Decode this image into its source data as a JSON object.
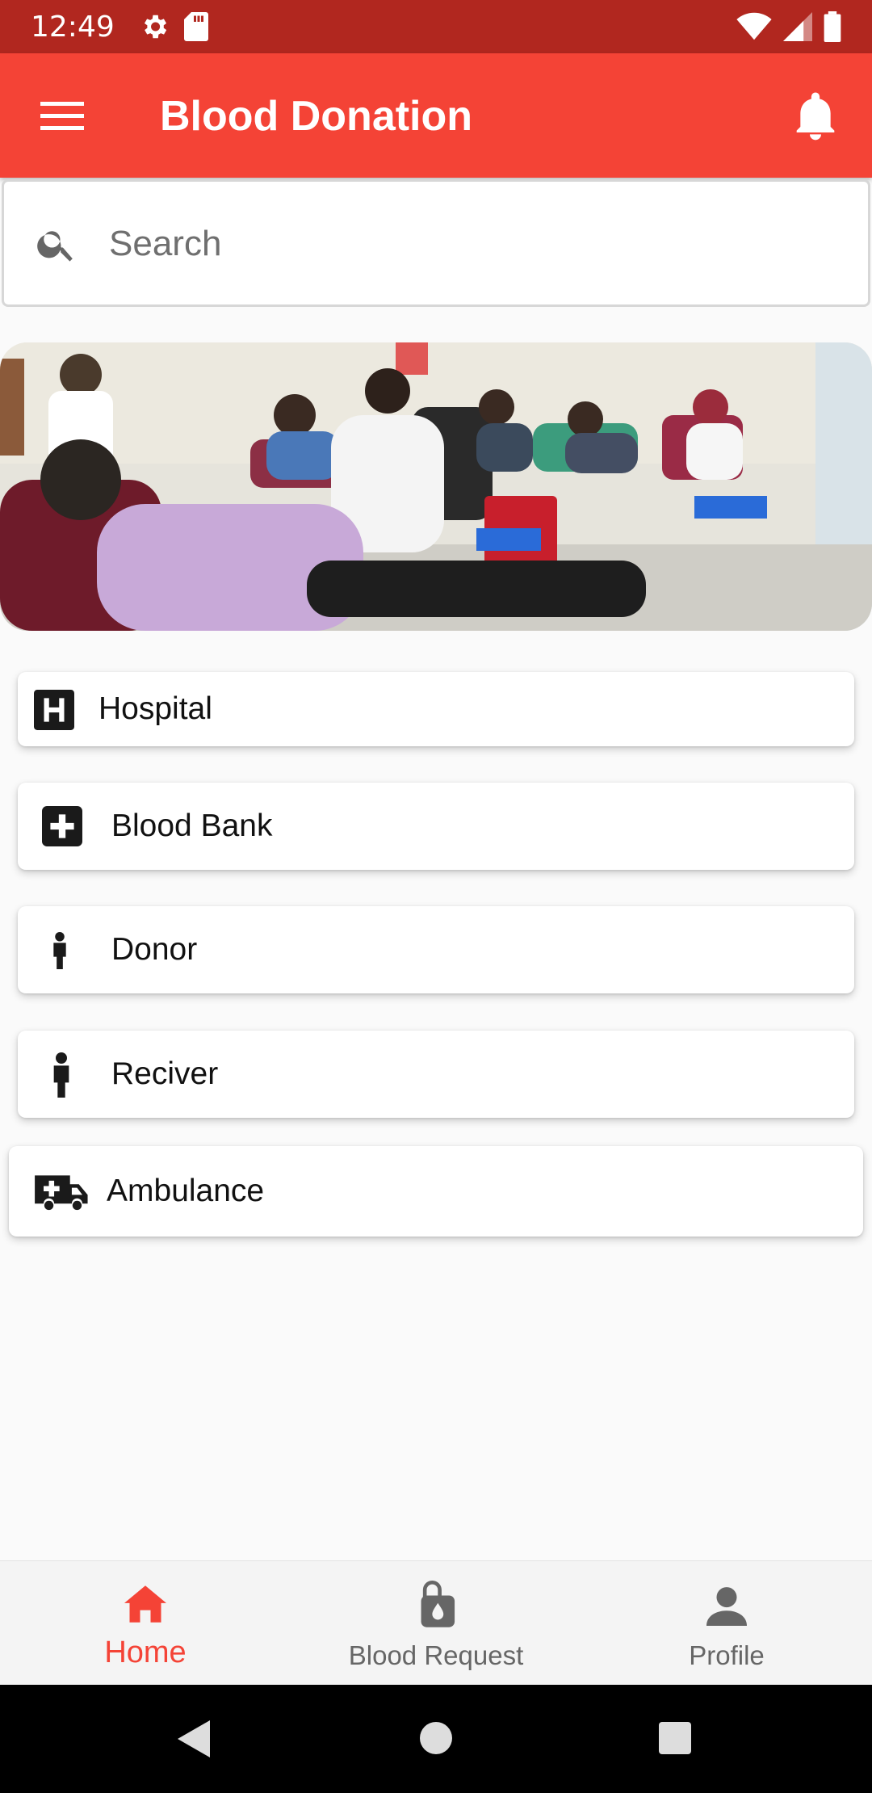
{
  "status_bar": {
    "time": "12:49",
    "icons": [
      "settings-icon",
      "sd-card-icon",
      "wifi-icon",
      "signal-icon",
      "battery-icon"
    ]
  },
  "app_bar": {
    "title": "Blood Donation",
    "menu_icon": "hamburger-menu-icon",
    "notification_icon": "bell-icon",
    "color": "#f44336"
  },
  "search": {
    "placeholder": "Search",
    "value": ""
  },
  "banner": {
    "image": "blood-donation-photo"
  },
  "menu_items": [
    {
      "label": "Hospital",
      "icon": "hospital-icon"
    },
    {
      "label": "Blood Bank",
      "icon": "blood-bank-icon"
    },
    {
      "label": "Donor",
      "icon": "person-icon"
    },
    {
      "label": "Reciver",
      "icon": "person-icon"
    },
    {
      "label": "Ambulance",
      "icon": "ambulance-icon"
    }
  ],
  "bottom_nav": {
    "items": [
      {
        "label": "Home",
        "icon": "home-icon",
        "active": true
      },
      {
        "label": "Blood Request",
        "icon": "blood-bag-icon",
        "active": false
      },
      {
        "label": "Profile",
        "icon": "person-icon",
        "active": false
      }
    ],
    "active_color": "#f44336"
  },
  "system_nav": {
    "buttons": [
      "back-button",
      "home-button",
      "recents-button"
    ]
  }
}
